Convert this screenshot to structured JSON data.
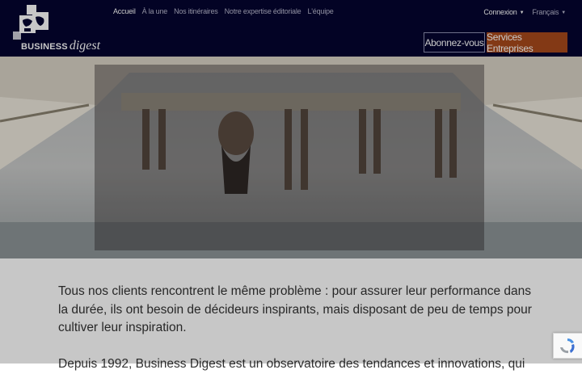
{
  "brand": {
    "business": "BUSINESS",
    "digest": "digest"
  },
  "nav": {
    "items": [
      {
        "label": "Accueil",
        "active": true
      },
      {
        "label": "À la une",
        "active": false
      },
      {
        "label": "Nos itinéraires",
        "active": false
      },
      {
        "label": "Notre expertise éditoriale",
        "active": false
      },
      {
        "label": "L'équipe",
        "active": false
      }
    ]
  },
  "account": {
    "login_label": "Connexion",
    "language_label": "Français"
  },
  "cta": {
    "subscribe_label": "Abonnez-vous",
    "enterprise_label": "Services Entreprises"
  },
  "content": {
    "paragraph_1": "Tous nos clients rencontrent le même problème : pour assurer leur performance dans la durée, ils ont besoin de décideurs inspirants, mais disposant de peu de temps pour cultiver leur inspiration.",
    "paragraph_2": "Depuis 1992, Business Digest est un observatoire des tendances et innovations, qui"
  },
  "colors": {
    "header_bg": "#050530",
    "enterprise_button": "#a8491c"
  },
  "icons": {
    "logo": "business-digest-logo-icon",
    "recaptcha": "recaptcha-icon"
  }
}
